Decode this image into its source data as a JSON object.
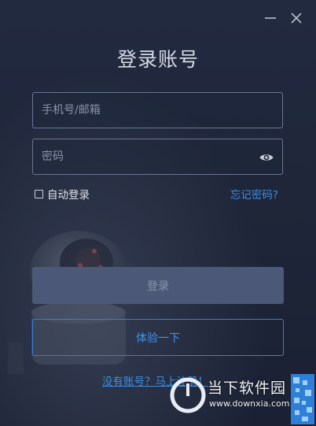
{
  "window": {
    "title": "登录账号",
    "minimize_icon": "minimize-icon",
    "close_icon": "close-icon"
  },
  "form": {
    "phone_placeholder": "手机号/邮箱",
    "phone_value": "",
    "password_placeholder": "密码",
    "password_value": "",
    "password_toggle_icon": "eye-icon",
    "remember_label": "自动登录",
    "remember_checked": false,
    "forgot_label": "忘记密码?"
  },
  "actions": {
    "login_label": "登录",
    "trial_label": "体验一下",
    "register_label": "没有账号？马上注册！"
  },
  "watermark": {
    "name": "当下软件园",
    "url": "www.downxia.com"
  },
  "colors": {
    "background": "#1f2639",
    "accent": "#3a8ee6",
    "login_button_bg": "#4b5877",
    "field_border": "#6a7590"
  }
}
